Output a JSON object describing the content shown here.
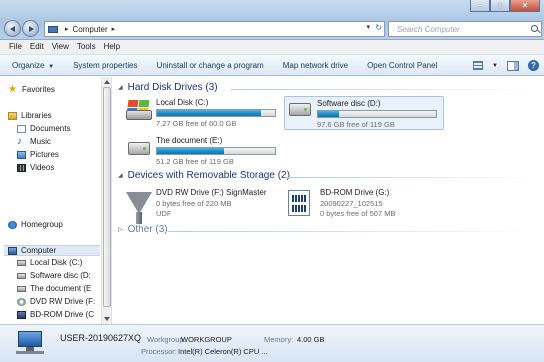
{
  "address": {
    "path_root": "Computer",
    "search_placeholder": "Search Computer"
  },
  "window_controls": {
    "minimize": "–",
    "maximize": "□",
    "close": "✕"
  },
  "menu": [
    "File",
    "Edit",
    "View",
    "Tools",
    "Help"
  ],
  "toolbar": {
    "organize": "Organize",
    "system_properties": "System properties",
    "uninstall": "Uninstall or change a program",
    "map_drive": "Map network drive",
    "control_panel": "Open Control Panel",
    "help": "?"
  },
  "nav": {
    "favorites": "Favorites",
    "libraries": "Libraries",
    "documents": "Documents",
    "music": "Music",
    "pictures": "Pictures",
    "videos": "Videos",
    "homegroup": "Homegroup",
    "computer": "Computer",
    "local_disk": "Local Disk (C:)",
    "software_disc": "Software disc (D:",
    "the_document": "The document (E",
    "dvd_drive": "DVD RW Drive (F:",
    "bd_drive": "BD-ROM Drive (C"
  },
  "groups": {
    "hard_disk": "Hard Disk Drives (3)",
    "removable": "Devices with Removable Storage (2)",
    "other": "Other (3)"
  },
  "drives": [
    {
      "name": "Local Disk (C:)",
      "free": "7.27 GB free of 60.0 GB",
      "used_fraction": 0.88
    },
    {
      "name": "Software disc (D:)",
      "free": "97.6 GB free of 119 GB",
      "used_fraction": 0.18
    },
    {
      "name": "The document (E:)",
      "free": "51.2 GB free of 119 GB",
      "used_fraction": 0.57
    }
  ],
  "removable": [
    {
      "name": "DVD RW Drive (F:) SignMaster",
      "line1": "0 bytes free of 220 MB",
      "line2": "UDF"
    },
    {
      "name": "BD-ROM Drive (G:)",
      "line1": "20090227_102515",
      "line2": "0 bytes free of 507 MB"
    }
  ],
  "details": {
    "computer_name": "USER-20190627XQ",
    "workgroup_label": "Workgroup:",
    "workgroup": "WORKGROUP",
    "memory_label": "Memory:",
    "memory": "4.00 GB",
    "processor_label": "Processor:",
    "processor": "Intel(R) Celeron(R) CPU ..."
  }
}
